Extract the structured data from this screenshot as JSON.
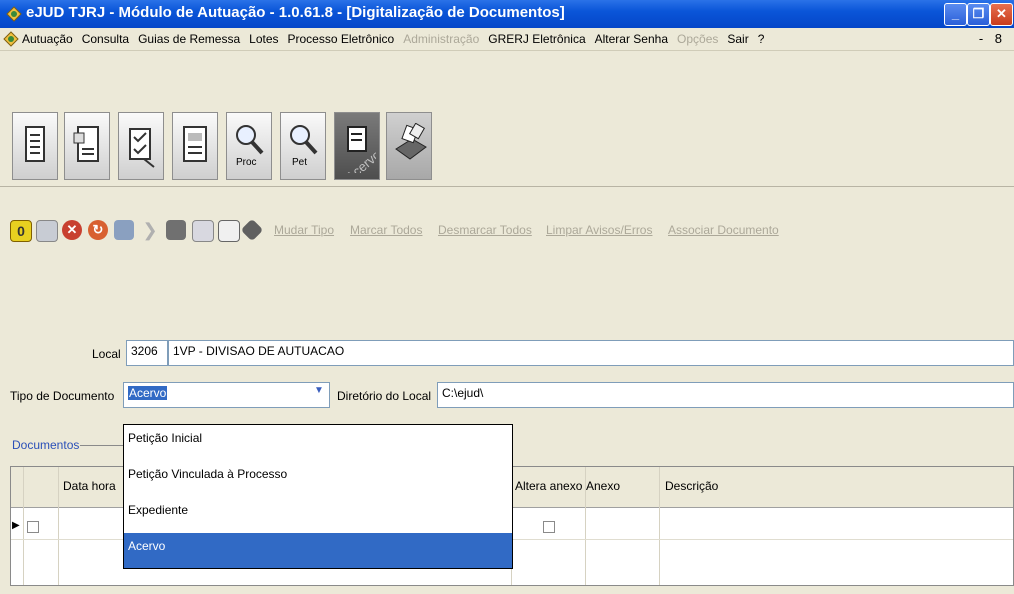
{
  "window": {
    "title": "eJUD TJRJ - Módulo de Autuação - 1.0.61.8 - [Digitalização de Documentos]",
    "controls": [
      "minimize",
      "restore",
      "close"
    ]
  },
  "menubar": {
    "items": [
      {
        "label": "Autuação",
        "enabled": true
      },
      {
        "label": "Consulta",
        "enabled": true
      },
      {
        "label": "Guias de Remessa",
        "enabled": true
      },
      {
        "label": "Lotes",
        "enabled": true
      },
      {
        "label": "Processo Eletrônico",
        "enabled": true
      },
      {
        "label": "Administração",
        "enabled": false
      },
      {
        "label": "GRERJ Eletrônica",
        "enabled": true
      },
      {
        "label": "Alterar Senha",
        "enabled": true
      },
      {
        "label": "Opções",
        "enabled": false
      },
      {
        "label": "Sair",
        "enabled": true
      },
      {
        "label": "?",
        "enabled": true
      }
    ],
    "mdi_controls": "- 8"
  },
  "big_toolbar": {
    "buttons": [
      {
        "icon": "document-icon"
      },
      {
        "icon": "document-list-icon"
      },
      {
        "icon": "checklist-icon"
      },
      {
        "icon": "report-icon"
      },
      {
        "icon": "search-icon",
        "label": "Proc"
      },
      {
        "icon": "search-icon",
        "label": "Pet"
      },
      {
        "icon": "document-stamp-icon",
        "label": "Acervo"
      },
      {
        "icon": "scanner-icon"
      }
    ]
  },
  "small_toolbar": {
    "icons": [
      "zero-icon",
      "save-icon",
      "cancel-icon",
      "refresh-icon",
      "edit-icon",
      "forward-icon",
      "attach-icon",
      "list-icon",
      "form-icon",
      "cube-icon"
    ],
    "links": [
      "Mudar Tipo",
      "Marcar Todos",
      "Desmarcar Todos",
      "Limpar Avisos/Erros",
      "Associar Documento"
    ]
  },
  "form": {
    "local_label": "Local",
    "local_code": "3206",
    "local_name": "1VP - DIVISAO DE AUTUACAO",
    "tipo_label": "Tipo de Documento",
    "tipo_value": "Acervo",
    "diretorio_label": "Diretório do Local",
    "diretorio_value": "C:\\ejud\\"
  },
  "documents": {
    "tab_label": "Documentos",
    "columns": [
      "Data hora",
      "Altera anexo",
      "Anexo",
      "Descrição"
    ]
  },
  "dropdown": {
    "options": [
      "Petição Inicial",
      "Petição Vinculada à Processo",
      "Expediente",
      "Acervo"
    ],
    "selected": "Acervo"
  },
  "colors": {
    "title_blue": "#0a55d8",
    "selection": "#316ac5",
    "disabled": "#aca899"
  }
}
